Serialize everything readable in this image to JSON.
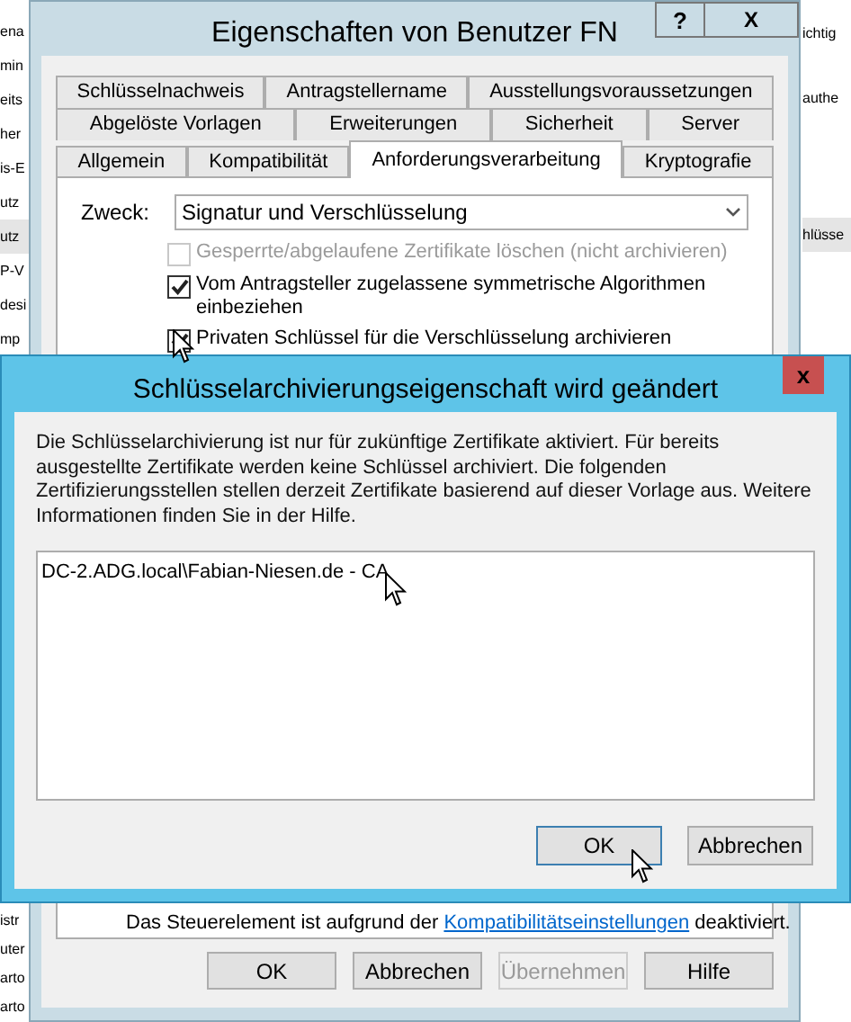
{
  "background_list": {
    "left": [
      {
        "text": "ena",
        "selected": false
      },
      {
        "text": "min",
        "selected": false
      },
      {
        "text": "eits",
        "selected": false
      },
      {
        "text": "her",
        "selected": false
      },
      {
        "text": "is-E",
        "selected": false
      },
      {
        "text": "utz",
        "selected": false
      },
      {
        "text": "utz",
        "selected": true
      },
      {
        "text": "P-V",
        "selected": false
      },
      {
        "text": "desi",
        "selected": false
      },
      {
        "text": "mp",
        "selected": false
      }
    ],
    "left_bottom": [
      "istr",
      "uter",
      "arto",
      "arto"
    ],
    "right": [
      {
        "text": "ichtig",
        "selected": false
      },
      {
        "text": "authe",
        "selected": false
      },
      {
        "text": "hlüsse",
        "selected": true
      }
    ]
  },
  "window": {
    "title": "Eigenschaften von Benutzer FN",
    "help_button": "?",
    "close_button": "X",
    "tab_rows": [
      [
        {
          "label": "Schlüsselnachweis",
          "selected": false
        },
        {
          "label": "Antragstellername",
          "selected": false
        },
        {
          "label": "Ausstellungsvoraussetzungen",
          "selected": false
        }
      ],
      [
        {
          "label": "Abgelöste Vorlagen",
          "selected": false
        },
        {
          "label": "Erweiterungen",
          "selected": false
        },
        {
          "label": "Sicherheit",
          "selected": false
        },
        {
          "label": "Server",
          "selected": false
        }
      ],
      [
        {
          "label": "Allgemein",
          "selected": false
        },
        {
          "label": "Kompatibilität",
          "selected": false
        },
        {
          "label": "Anforderungsverarbeitung",
          "selected": true
        },
        {
          "label": "Kryptografie",
          "selected": false
        }
      ]
    ],
    "purpose": {
      "label": "Zweck:",
      "value": "Signatur und Verschlüsselung"
    },
    "options": [
      {
        "label": "Gesperrte/abgelaufene Zertifikate löschen (nicht archivieren)",
        "checked": false,
        "disabled": true
      },
      {
        "label": "Vom Antragsteller zugelassene symmetrische Algorithmen einbeziehen",
        "checked": true,
        "disabled": false
      },
      {
        "label": "Privaten Schlüssel für die Verschlüsselung archivieren",
        "checked": true,
        "disabled": false
      }
    ],
    "notice": {
      "before": "Das Steuerelement ist aufgrund der",
      "link": "Kompatibilitätseinstellungen",
      "after": "deaktiviert."
    },
    "buttons": [
      {
        "label": "OK",
        "disabled": false
      },
      {
        "label": "Abbrechen",
        "disabled": false
      },
      {
        "label": "Übernehmen",
        "disabled": true
      },
      {
        "label": "Hilfe",
        "disabled": false
      }
    ]
  },
  "dialog": {
    "title": "Schlüsselarchivierungseigenschaft wird geändert",
    "close_button": "x",
    "message": "Die Schlüsselarchivierung ist nur für zukünftige Zertifikate aktiviert. Für bereits ausgestellte Zertifikate werden keine Schlüssel archiviert. Die folgenden Zertifizierungsstellen stellen derzeit Zertifikate basierend auf dieser Vorlage aus. Weitere Informationen finden Sie in der Hilfe.",
    "list": [
      "DC-2.ADG.local\\Fabian-Niesen.de - CA"
    ],
    "buttons": [
      {
        "label": "OK",
        "default": true
      },
      {
        "label": "Abbrechen",
        "default": false
      }
    ]
  }
}
